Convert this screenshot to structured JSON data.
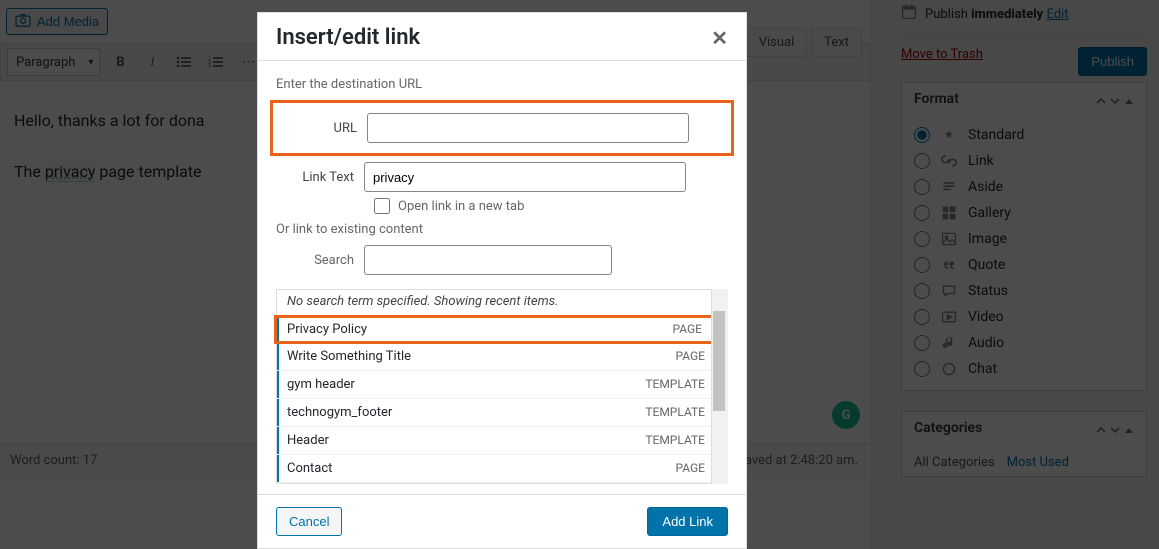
{
  "editor": {
    "add_media": "Add Media",
    "tabs": {
      "visual": "Visual",
      "text": "Text"
    },
    "format_select": "Paragraph",
    "content_line1": "Hello, thanks a lot for dona",
    "content_line2_pre": "The ",
    "content_line2_link": "privacy",
    "content_line2_post": " page template",
    "word_count_label": "Word count: 17",
    "saved_label": "aved at 2:48:20 am.",
    "grammarly": "G"
  },
  "sidebar": {
    "publish_pre": "Publish ",
    "publish_bold": "immediately",
    "edit": "Edit",
    "trash": "Move to Trash",
    "publish_btn": "Publish",
    "format_title": "Format",
    "formats": [
      {
        "label": "Standard",
        "icon": "pin",
        "checked": true
      },
      {
        "label": "Link",
        "icon": "link",
        "checked": false
      },
      {
        "label": "Aside",
        "icon": "aside",
        "checked": false
      },
      {
        "label": "Gallery",
        "icon": "gallery",
        "checked": false
      },
      {
        "label": "Image",
        "icon": "image",
        "checked": false
      },
      {
        "label": "Quote",
        "icon": "quote",
        "checked": false
      },
      {
        "label": "Status",
        "icon": "status",
        "checked": false
      },
      {
        "label": "Video",
        "icon": "video",
        "checked": false
      },
      {
        "label": "Audio",
        "icon": "audio",
        "checked": false
      },
      {
        "label": "Chat",
        "icon": "chat",
        "checked": false
      }
    ],
    "categories_title": "Categories",
    "cat_all": "All Categories",
    "cat_most": "Most Used"
  },
  "modal": {
    "title": "Insert/edit link",
    "enter_dest": "Enter the destination URL",
    "url_label": "URL",
    "url_value": "",
    "linktext_label": "Link Text",
    "linktext_value": "privacy",
    "new_tab_label": "Open link in a new tab",
    "or_link": "Or link to existing content",
    "search_label": "Search",
    "search_value": "",
    "results_head": "No search term specified. Showing recent items.",
    "results": [
      {
        "title": "Privacy Policy",
        "type": "PAGE"
      },
      {
        "title": "Write Something Title",
        "type": "PAGE"
      },
      {
        "title": "gym header",
        "type": "TEMPLATE"
      },
      {
        "title": "technogym_footer",
        "type": "TEMPLATE"
      },
      {
        "title": "Header",
        "type": "TEMPLATE"
      },
      {
        "title": "Contact",
        "type": "PAGE"
      }
    ],
    "cancel": "Cancel",
    "add": "Add Link"
  },
  "icons": {
    "camera": "📷",
    "calendar": "📅",
    "pin": "📌",
    "link": "🔗",
    "aside": "▤",
    "gallery": "▦",
    "image": "🖼",
    "quote": "❝",
    "status": "💬",
    "video": "▶",
    "audio": "♪",
    "chat": "○"
  }
}
